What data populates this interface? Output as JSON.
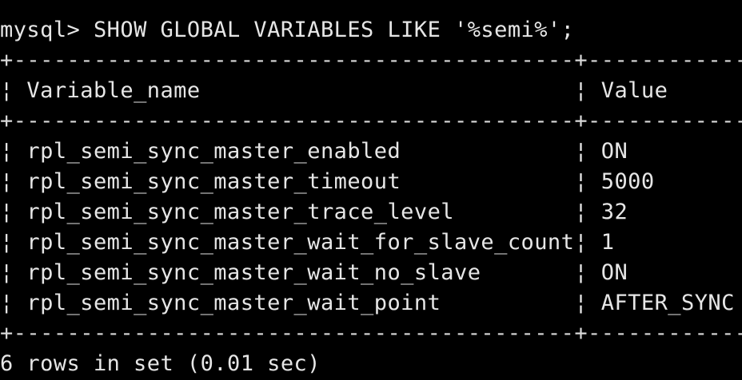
{
  "terminal": {
    "prompt": "mysql> ",
    "command": "SHOW GLOBAL VARIABLES LIKE '%semi%';",
    "border_top": "+------------------------------------------+------------+",
    "border_mid": "+------------------------------------------+------------+",
    "border_bottom": "+------------------------------------------+------------+",
    "header": {
      "name": "Variable_name",
      "value": "Value"
    },
    "rows": [
      {
        "name": "rpl_semi_sync_master_enabled",
        "value": "ON"
      },
      {
        "name": "rpl_semi_sync_master_timeout",
        "value": "5000"
      },
      {
        "name": "rpl_semi_sync_master_trace_level",
        "value": "32"
      },
      {
        "name": "rpl_semi_sync_master_wait_for_slave_count",
        "value": "1"
      },
      {
        "name": "rpl_semi_sync_master_wait_no_slave",
        "value": "ON"
      },
      {
        "name": "rpl_semi_sync_master_wait_point",
        "value": "AFTER_SYNC"
      }
    ],
    "footer": "6 rows in set (0.01 sec)",
    "colors": {
      "background": "#000000",
      "text": "#e6e6e6"
    }
  }
}
